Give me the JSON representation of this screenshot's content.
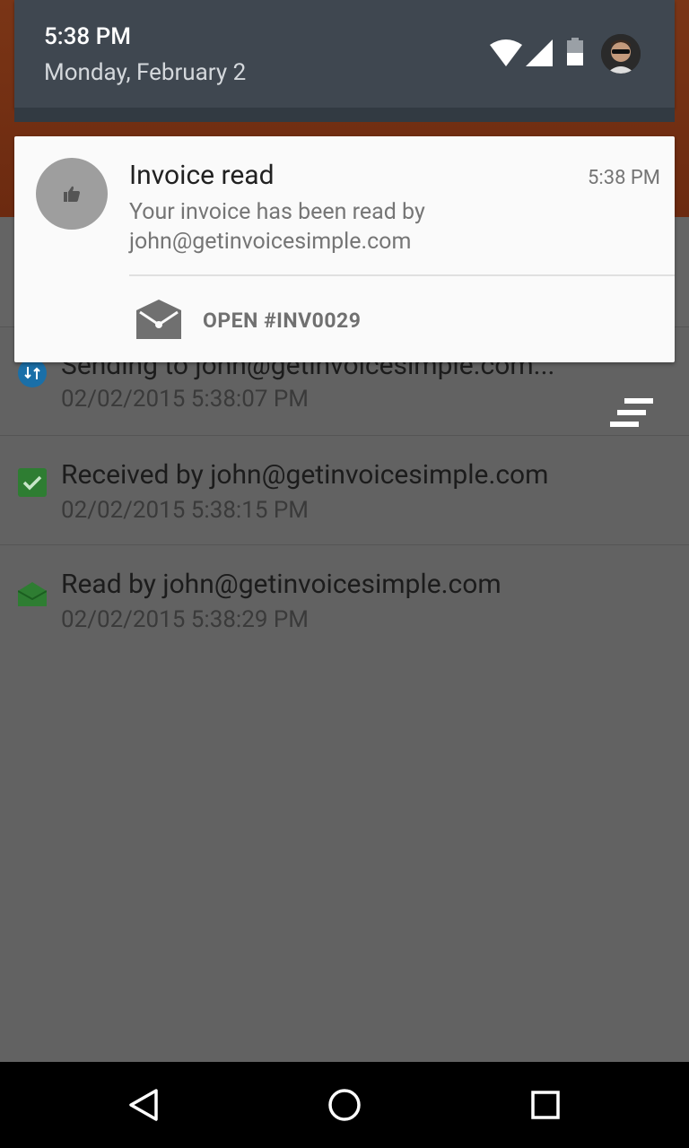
{
  "status_bar": {
    "time": "5:38 PM",
    "date": "Monday, February 2",
    "icons": [
      "wifi-icon",
      "cell-signal-icon",
      "battery-icon",
      "user-avatar"
    ]
  },
  "notification": {
    "icon": "thumbs-up-icon",
    "title": "Invoice read",
    "time": "5:38 PM",
    "text": "Your invoice has been read by john@getinvoicesimple.com",
    "action_icon": "open-envelope-icon",
    "action_label": "OPEN #INV0029"
  },
  "history": [
    {
      "icon": "sync-icon",
      "title": "Sending to john@getinvoicesimple.com...",
      "timestamp": "02/02/2015 5:38:07 PM"
    },
    {
      "icon": "check-icon",
      "title": "Received by john@getinvoicesimple.com",
      "timestamp": "02/02/2015 5:38:15 PM"
    },
    {
      "icon": "open-envelope-icon",
      "title": "Read by john@getinvoicesimple.com",
      "timestamp": "02/02/2015 5:38:29 PM"
    }
  ],
  "navbar": {
    "buttons": [
      "back-icon",
      "home-icon",
      "recents-icon"
    ]
  },
  "colors": {
    "notification_bg": "#fafafa",
    "shade_header": "#3f4750",
    "app_bar": "#6e2c12",
    "sync_icon": "#1a6fa8",
    "check_icon": "#2e7d32",
    "envelope_icon": "#2e7d32"
  }
}
